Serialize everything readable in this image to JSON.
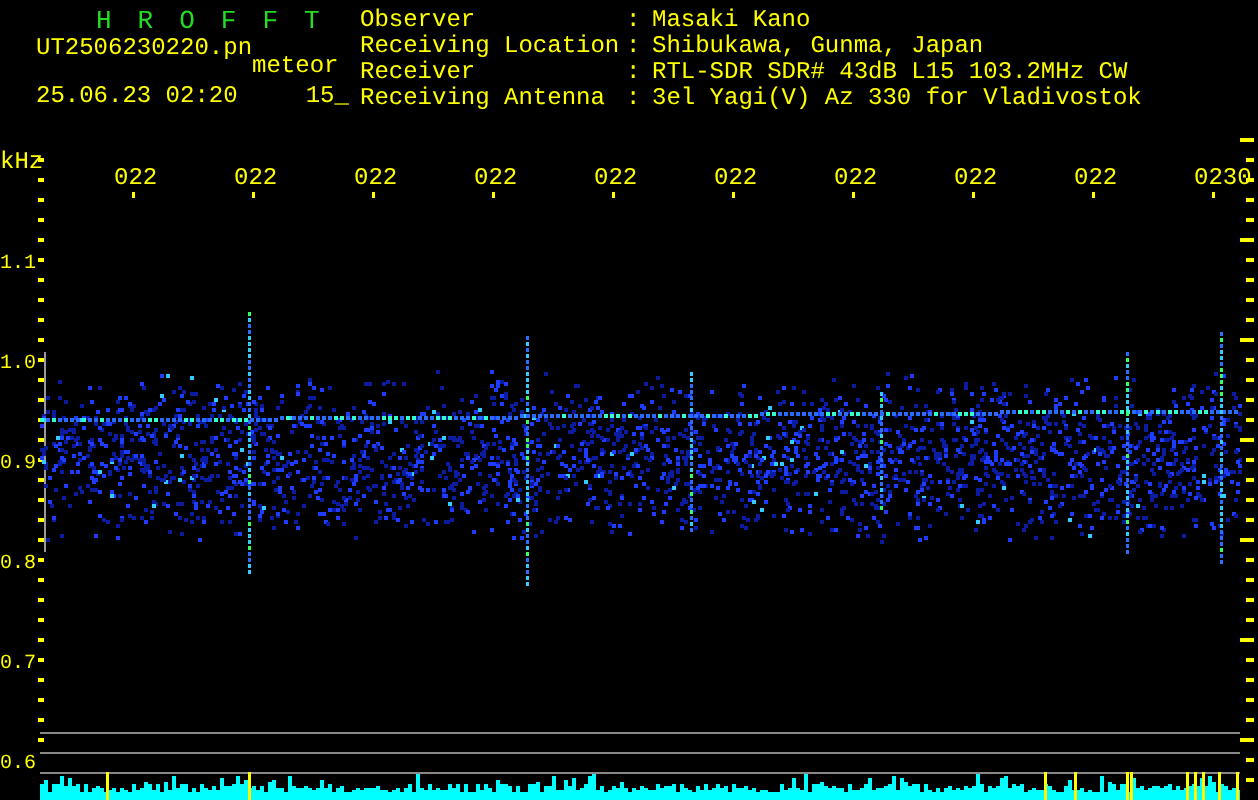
{
  "header": {
    "title": "HROFFT",
    "filename": "UT2506230220.pn",
    "mode": "meteor",
    "datetime": "25.06.23 02:20",
    "count": "15_"
  },
  "info": [
    {
      "label": "Observer",
      "separator": ":",
      "value": "Masaki Kano"
    },
    {
      "label": "Receiving Location",
      "separator": ":",
      "value": "Shibukawa, Gunma, Japan"
    },
    {
      "label": "Receiver",
      "separator": ":",
      "value": "RTL-SDR SDR# 43dB L15 103.2MHz CW"
    },
    {
      "label": "Receiving Antenna",
      "separator": ":",
      "value": "3el Yagi(V) Az 330 for Vladivostok"
    }
  ],
  "plot": {
    "unit": "kHz",
    "time_labels": [
      "022",
      "022",
      "022",
      "022",
      "022",
      "022",
      "022",
      "022",
      "022",
      "0230"
    ],
    "freq_labels": [
      "1.1",
      "1.0",
      "0.9",
      "0.8",
      "0.7",
      "0.6"
    ]
  }
}
